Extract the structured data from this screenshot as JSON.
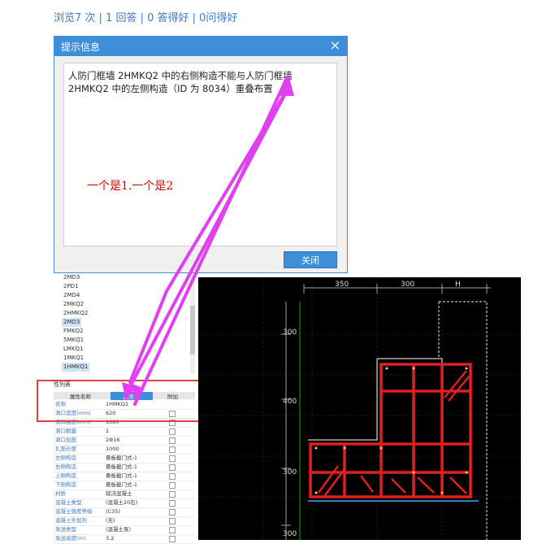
{
  "stats": {
    "text": "浏览7 次 | 1 回答 | 0 答得好 | 0问得好"
  },
  "dialog": {
    "title": "提示信息",
    "close_glyph": "×",
    "message": "人防门框墙 2HMKQ2 中的右侧构造不能与人防门框墙 2HMKQ2 中的左侧构造（ID 为 8034）重叠布置",
    "button": "关闭"
  },
  "annotation": {
    "text": "一个是1.一个是2",
    "color": "#e00000"
  },
  "component_list": [
    "2MD3",
    "2PD1",
    "2MD4",
    "2MKQ2",
    "2HMKQ2",
    "2MD3",
    "FMKQ2",
    "5MKQ1",
    "LMKQ1",
    "1MKQ1",
    "1HMKQ1"
  ],
  "selected_item": "1HMKQ1",
  "properties": {
    "title": "性列表",
    "headers": [
      "属性名称",
      "属性值",
      "附加"
    ],
    "rows": [
      {
        "name": "名称",
        "value": "1HMKQ1"
      },
      {
        "name": "洞口宽度(mm)",
        "value": "620"
      },
      {
        "name": "洞口高度(mm)",
        "value": "1080"
      },
      {
        "name": "洞口数量",
        "value": "1"
      },
      {
        "name": "洞口加筋",
        "value": "2Φ16"
      },
      {
        "name": "扎筋长度",
        "value": "1000"
      },
      {
        "name": "左侧构造",
        "value": "悬板截门式-1"
      },
      {
        "name": "右侧构造",
        "value": "悬板截门式-1"
      },
      {
        "name": "上侧构造",
        "value": "悬板截门式-1"
      },
      {
        "name": "下侧构造",
        "value": "悬板截门式-1"
      },
      {
        "name": "材质",
        "value": "现浇混凝土"
      },
      {
        "name": "混凝土类型",
        "value": "(混凝土20石)"
      },
      {
        "name": "混凝土强度等级",
        "value": "(C35)"
      },
      {
        "name": "混凝土外加剂",
        "value": "(无)"
      },
      {
        "name": "泵送类型",
        "value": "(混凝土泵)"
      },
      {
        "name": "泵送高度(m)",
        "value": "3.2"
      }
    ]
  },
  "cad": {
    "dim_top": [
      "350",
      "300",
      "H"
    ],
    "dim_left": [
      "300",
      "400",
      "300",
      "300"
    ],
    "colors": {
      "background": "#000000",
      "rebar": "#e02020",
      "dim": "#dddddd",
      "green": "#22cc22"
    }
  },
  "arrow_color": "#e040f0"
}
